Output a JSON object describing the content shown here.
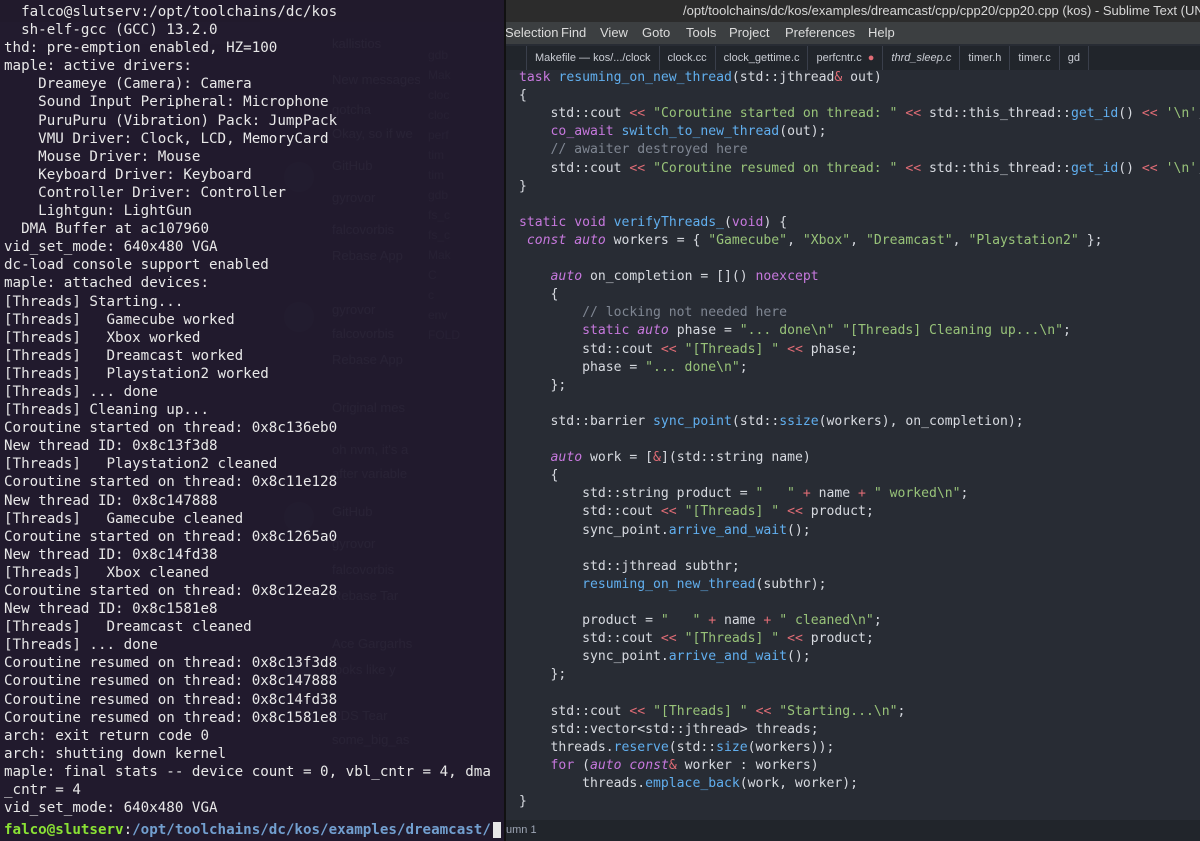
{
  "sublime": {
    "title": "/opt/toolchains/dc/kos/examples/dreamcast/cpp/cpp20/cpp20.cpp (kos) - Sublime Text (UN",
    "menu": [
      "Selection",
      "Find",
      "View",
      "Goto",
      "Tools",
      "Project",
      "Preferences",
      "Help"
    ],
    "tabs": [
      {
        "label": "Makefile — kos/.../clock",
        "italic": false,
        "dirty": false
      },
      {
        "label": "clock.cc",
        "italic": false,
        "dirty": false
      },
      {
        "label": "clock_gettime.c",
        "italic": false,
        "dirty": false
      },
      {
        "label": "perfcntr.c",
        "italic": false,
        "dirty": true
      },
      {
        "label": "thrd_sleep.c",
        "italic": true,
        "dirty": false
      },
      {
        "label": "timer.h",
        "italic": false,
        "dirty": false
      },
      {
        "label": "timer.c",
        "italic": false,
        "dirty": false
      },
      {
        "label": "gd",
        "italic": false,
        "dirty": false
      }
    ],
    "status": "umn 1",
    "code": [
      "task resuming_on_new_thread(std::jthread& out)",
      "{",
      "    std::cout << \"Coroutine started on thread: \" << std::this_thread::get_id() << '\\n';",
      "    co_await switch_to_new_thread(out);",
      "    // awaiter destroyed here",
      "    std::cout << \"Coroutine resumed on thread: \" << std::this_thread::get_id() << '\\n';",
      "}",
      "",
      "static void verifyThreads_(void) {",
      " const auto workers = { \"Gamecube\", \"Xbox\", \"Dreamcast\", \"Playstation2\" };",
      "",
      "    auto on_completion = []() noexcept",
      "    {",
      "        // locking not needed here",
      "        static auto phase = \"... done\\n\" \"[Threads] Cleaning up...\\n\";",
      "        std::cout << \"[Threads] \" << phase;",
      "        phase = \"... done\\n\";",
      "    };",
      "",
      "    std::barrier sync_point(std::ssize(workers), on_completion);",
      "",
      "    auto work = [&](std::string name)",
      "    {",
      "        std::string product = \"   \" + name + \" worked\\n\";",
      "        std::cout << \"[Threads] \" << product;",
      "        sync_point.arrive_and_wait();",
      "",
      "        std::jthread subthr;",
      "        resuming_on_new_thread(subthr);",
      "",
      "        product = \"   \" + name + \" cleaned\\n\";",
      "        std::cout << \"[Threads] \" << product;",
      "        sync_point.arrive_and_wait();",
      "    };",
      "",
      "    std::cout << \"[Threads] \" << \"Starting...\\n\";",
      "    std::vector<std::jthread> threads;",
      "    threads.reserve(std::size(workers));",
      "    for (auto const& worker : workers)",
      "        threads.emplace_back(work, worker);",
      "}"
    ]
  },
  "chat": {
    "lines": [
      "kallistios",
      "New messages since 2",
      "gotcha",
      "Okay, so if we",
      "GitHub",
      "gyrovor",
      "falcovorbis",
      "Rebase App",
      "gyrovor",
      "falcovorbis",
      "Rebase App",
      "Original mes",
      "oh nvm, it's a",
      "after variable",
      "GitHub",
      "gyrovor",
      "falcovorbis",
      "Rebase Tar",
      "Ace Gargarhs",
      "looks like y",
      "PDS Tear",
      "some_big_as"
    ],
    "sidebar": [
      "gdb",
      "Mak",
      "cloc",
      "cloc",
      "perf",
      "tim",
      "tim",
      "gdb",
      "fs_c",
      "fs_c",
      "Mak",
      "C",
      "c",
      "env",
      "FOLD"
    ]
  },
  "terminal": {
    "lines": [
      "  falco@slutserv:/opt/toolchains/dc/kos",
      "  sh-elf-gcc (GCC) 13.2.0",
      "thd: pre-emption enabled, HZ=100",
      "maple: active drivers:",
      "    Dreameye (Camera): Camera",
      "    Sound Input Peripheral: Microphone",
      "    PuruPuru (Vibration) Pack: JumpPack",
      "    VMU Driver: Clock, LCD, MemoryCard",
      "    Mouse Driver: Mouse",
      "    Keyboard Driver: Keyboard",
      "    Controller Driver: Controller",
      "    Lightgun: LightGun",
      "  DMA Buffer at ac107960",
      "vid_set_mode: 640x480 VGA",
      "dc-load console support enabled",
      "maple: attached devices:",
      "[Threads] Starting...",
      "[Threads]   Gamecube worked",
      "[Threads]   Xbox worked",
      "[Threads]   Dreamcast worked",
      "[Threads]   Playstation2 worked",
      "[Threads] ... done",
      "[Threads] Cleaning up...",
      "Coroutine started on thread: 0x8c136eb0",
      "New thread ID: 0x8c13f3d8",
      "[Threads]   Playstation2 cleaned",
      "Coroutine started on thread: 0x8c11e128",
      "New thread ID: 0x8c147888",
      "[Threads]   Gamecube cleaned",
      "Coroutine started on thread: 0x8c1265a0",
      "New thread ID: 0x8c14fd38",
      "[Threads]   Xbox cleaned",
      "Coroutine started on thread: 0x8c12ea28",
      "New thread ID: 0x8c1581e8",
      "[Threads]   Dreamcast cleaned",
      "[Threads] ... done",
      "Coroutine resumed on thread: 0x8c13f3d8",
      "Coroutine resumed on thread: 0x8c147888",
      "Coroutine resumed on thread: 0x8c14fd38",
      "Coroutine resumed on thread: 0x8c1581e8",
      "arch: exit return code 0",
      "arch: shutting down kernel",
      "maple: final stats -- device count = 0, vbl_cntr = 4, dma",
      "_cntr = 4",
      "vid_set_mode: 640x480 VGA"
    ],
    "prompt_user": "falco@slutserv",
    "prompt_sep": ":",
    "prompt_path": "/opt/toolchains/dc/kos/examples/dreamcast/",
    "prompt_symbol": "$"
  }
}
